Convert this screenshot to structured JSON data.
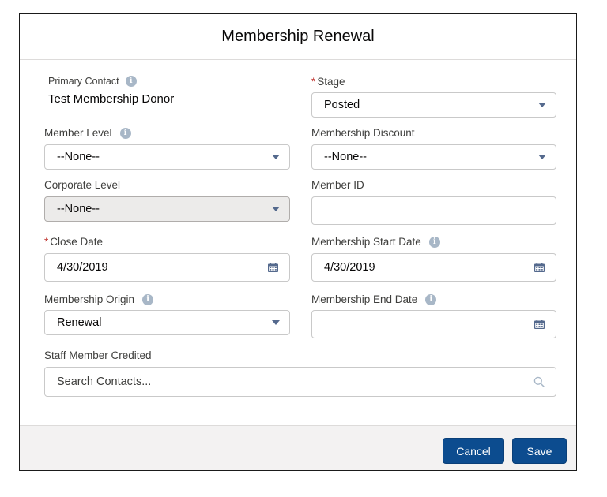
{
  "modal": {
    "title": "Membership Renewal"
  },
  "fields": {
    "primary_contact": {
      "label": "Primary Contact",
      "value": "Test Membership Donor"
    },
    "stage": {
      "label": "Stage",
      "value": "Posted"
    },
    "member_level": {
      "label": "Member Level",
      "value": "--None--"
    },
    "membership_discount": {
      "label": "Membership Discount",
      "value": "--None--"
    },
    "corporate_level": {
      "label": "Corporate Level",
      "value": "--None--"
    },
    "member_id": {
      "label": "Member ID",
      "value": ""
    },
    "close_date": {
      "label": "Close Date",
      "value": "4/30/2019"
    },
    "membership_start_date": {
      "label": "Membership Start Date",
      "value": "4/30/2019"
    },
    "membership_origin": {
      "label": "Membership Origin",
      "value": "Renewal"
    },
    "membership_end_date": {
      "label": "Membership End Date",
      "value": ""
    },
    "staff_member_credited": {
      "label": "Staff Member Credited",
      "placeholder": "Search Contacts..."
    }
  },
  "required_marker": "*",
  "info_glyph": "i",
  "footer": {
    "cancel_label": "Cancel",
    "save_label": "Save"
  },
  "colors": {
    "brand_button": "#0c4c8f",
    "required": "#c23934",
    "info_icon": "#a8b7c7"
  },
  "icons": {
    "info": "info-icon",
    "dropdown": "chevron-down-icon",
    "calendar": "calendar-icon",
    "search": "search-icon"
  }
}
